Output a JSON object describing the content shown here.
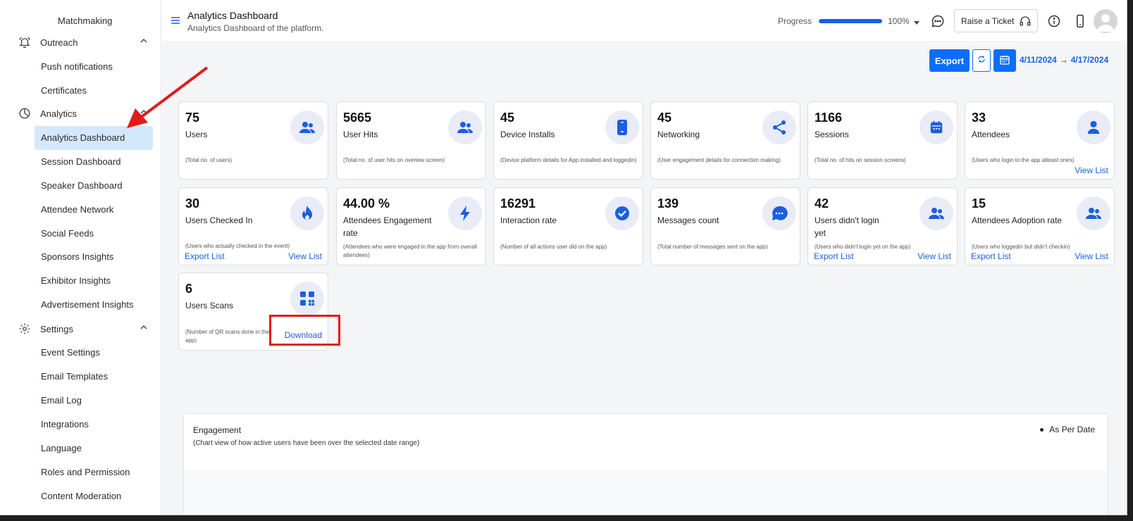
{
  "sidebar": {
    "top_item": "Matchmaking",
    "sections": {
      "outreach": "Outreach",
      "analytics": "Analytics",
      "settings": "Settings"
    },
    "outreach_items": [
      "Push notifications",
      "Certificates"
    ],
    "analytics_items": [
      "Analytics Dashboard",
      "Session Dashboard",
      "Speaker Dashboard",
      "Attendee Network",
      "Social Feeds",
      "Sponsors Insights",
      "Exhibitor Insights",
      "Advertisement Insights"
    ],
    "settings_items": [
      "Event Settings",
      "Email Templates",
      "Email Log",
      "Integrations",
      "Language",
      "Roles and Permission",
      "Content Moderation"
    ]
  },
  "header": {
    "title": "Analytics Dashboard",
    "subtitle": "Analytics Dashboard of the platform.",
    "progress_label": "Progress",
    "progress_value": "100%",
    "progress_fraction": 1.0,
    "raise_ticket": "Raise a Ticket"
  },
  "toolbar": {
    "export": "Export",
    "date_from": "4/11/2024",
    "date_arrow": "→",
    "date_to": "4/17/2024"
  },
  "cards": [
    {
      "value": "75",
      "label": "Users",
      "desc": "(Total no. of users)",
      "icon": "users-icon"
    },
    {
      "value": "5665",
      "label": "User Hits",
      "desc": "(Total no. of user hits on overiew screen)",
      "icon": "users-icon"
    },
    {
      "value": "45",
      "label": "Device Installs",
      "desc": "(Device platform details for App installed and loggedin)",
      "icon": "device-icon"
    },
    {
      "value": "45",
      "label": "Networking",
      "desc": "(User engagement details for connection making)",
      "icon": "share-icon"
    },
    {
      "value": "1166",
      "label": "Sessions",
      "desc": "(Total no. of hits on session screens)",
      "icon": "calendar-icon"
    },
    {
      "value": "33",
      "label": "Attendees",
      "desc": "(Users who login to the app atleast ones)",
      "icon": "user-icon",
      "view": "View List"
    },
    {
      "value": "30",
      "label": "Users Checked In",
      "desc": "(Users who actually checked in the event)",
      "icon": "flame-icon",
      "export": "Export List",
      "view": "View List"
    },
    {
      "value": "44.00 %",
      "label": "Attendees Engagement rate",
      "desc": "(Attendees who were engaged in the app from overall attendees)",
      "icon": "bolt-icon"
    },
    {
      "value": "16291",
      "label": "Interaction rate",
      "desc": "(Number of all actions user did on the app)",
      "icon": "check-circle-icon"
    },
    {
      "value": "139",
      "label": "Messages count",
      "desc": "(Total number of messages sent on the app)",
      "icon": "chat-icon"
    },
    {
      "value": "42",
      "label": "Users didn't login yet",
      "desc": "(Users who didn't login yet on the app)",
      "icon": "users-icon",
      "export": "Export List",
      "view": "View List"
    },
    {
      "value": "15",
      "label": "Attendees Adoption rate",
      "desc": "(Users who loggedin but didn't checkin)",
      "icon": "users-icon",
      "export": "Export List",
      "view": "View List"
    },
    {
      "value": "6",
      "label": "Users Scans",
      "desc": "(Number of QR scans done in the app)",
      "icon": "qr-icon",
      "download": "Download"
    }
  ],
  "engagement": {
    "title": "Engagement",
    "subtitle": "(Chart view of how active users have been over the selected date range)",
    "legend": "As Per Date"
  },
  "colors": {
    "accent": "#0d6efd",
    "link": "#1a5fe0",
    "annotation": "#e11b1b",
    "active_bg": "#d4e8fb"
  }
}
